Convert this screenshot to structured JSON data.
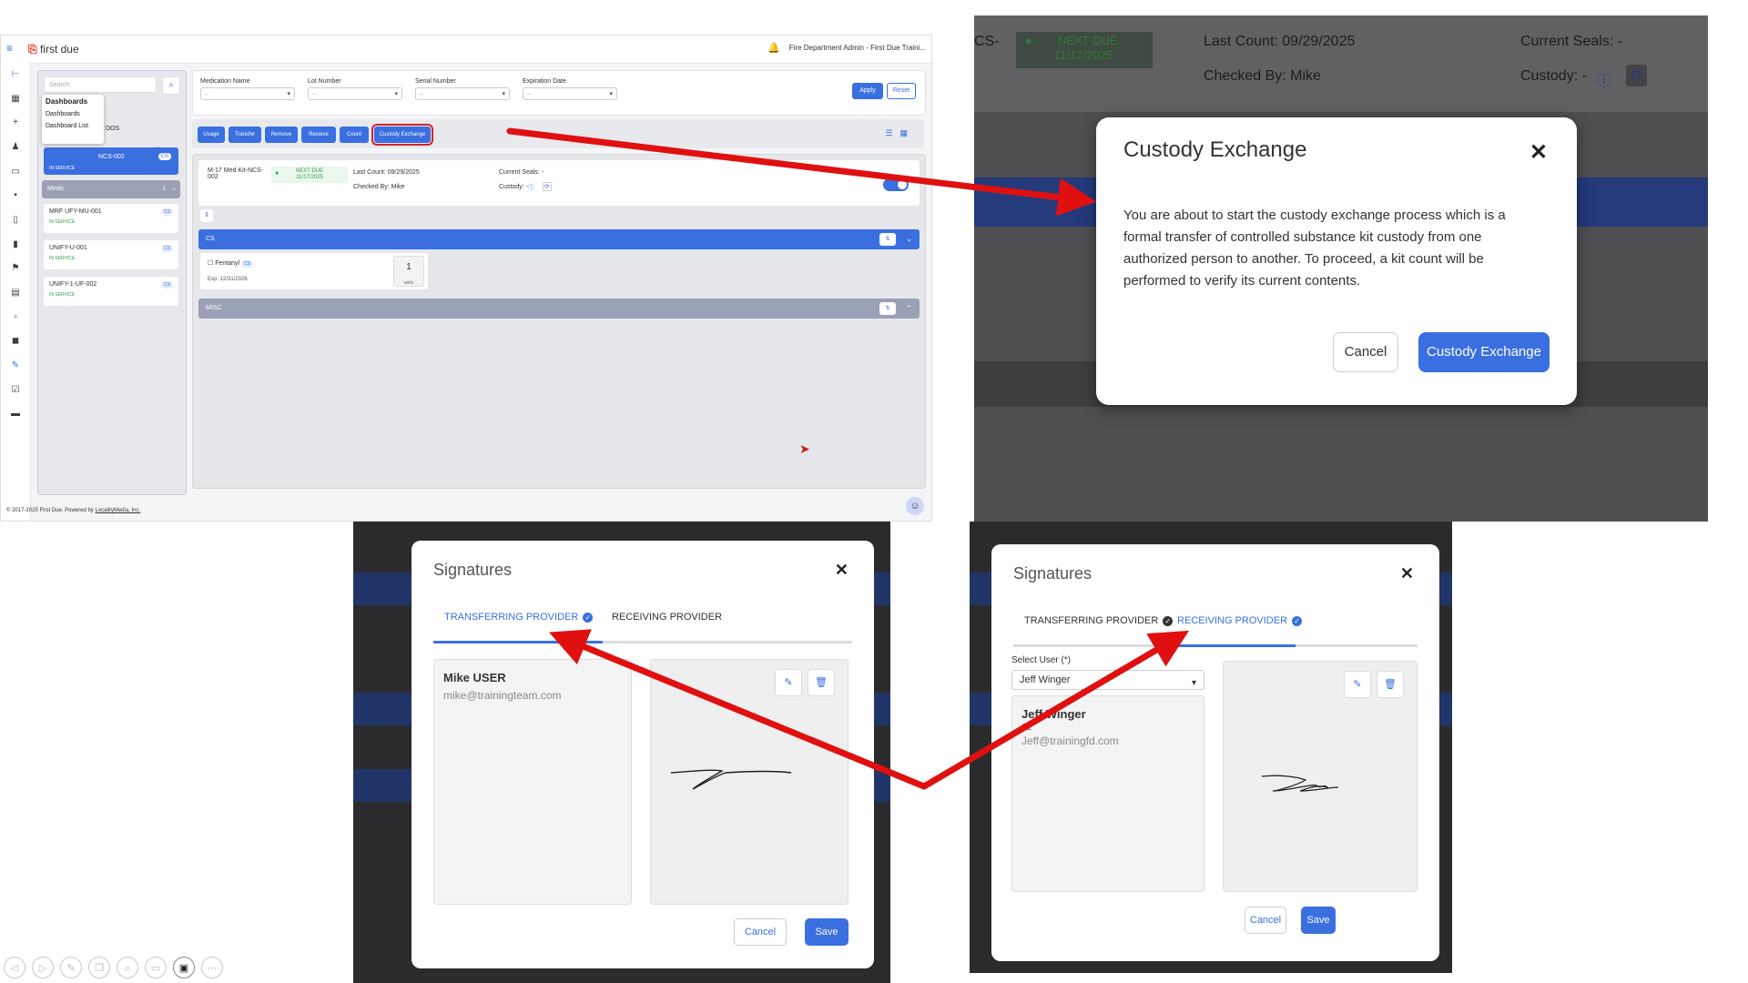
{
  "app": {
    "logo": "first due",
    "user_label": "Fire Department Admin - First Due Traini...",
    "search_placeholder": "Search",
    "dash_menu": [
      "Dashboards",
      "Dashboards",
      "Dashboard List"
    ],
    "partial_header": "DOS",
    "selected_kit": "NCS-002",
    "selected_kit_badge": "CS",
    "selected_kit_status": "IN SERVICE",
    "group_medic": "Medic",
    "group_medic_count": "1",
    "units": [
      {
        "name": "MRF UFY-MU-001",
        "status": "IN SERVICE",
        "badge": "CS"
      },
      {
        "name": "UNIFY-U-001",
        "status": "IN SERVICE",
        "badge": "CS"
      },
      {
        "name": "UNIFY-1-UF-002",
        "status": "IN SERVICE",
        "badge": "CS"
      }
    ],
    "filters": [
      {
        "label": "Medication Name",
        "value": "--"
      },
      {
        "label": "Lot Number",
        "value": "--"
      },
      {
        "label": "Serial Number",
        "value": "--"
      },
      {
        "label": "Expiration Date",
        "value": "--"
      }
    ],
    "apply": "Apply",
    "reset": "Reset",
    "actions": [
      "Usage",
      "Transfer",
      "Remove",
      "Receive",
      "Count",
      "Custody Exchange"
    ],
    "kit_name": "M-17 Med Kit-NCS-002",
    "next_due": "NEXT DUE",
    "next_due_date": "11/17/2025",
    "last_count": "Last Count: 09/29/2025",
    "checked_by": "Checked By: Mike",
    "current_seals": "Current Seals: -",
    "custody": "Custody: -",
    "section_cs": "CS",
    "section_misc": "MISC",
    "med_name": "Fentanyl",
    "med_badge": "CS",
    "med_exp": "Exp: 12/31/2026",
    "med_count": "1",
    "med_units": "units",
    "footer_text": "© 2017-2025 First Due. Powered by ",
    "footer_link": "LocalityMedia, Inc."
  },
  "custody_shot": {
    "bg_prefix": "CS-",
    "next_due": "NEXT DUE",
    "next_due_date": "11/17/2025",
    "last_count_label": "Last Count:",
    "last_count_value": "09/29/2025",
    "checked_by_label": "Checked By:",
    "checked_by_value": "Mike",
    "current_seals": "Current Seals: -",
    "custody": "Custody: -",
    "modal_title": "Custody Exchange",
    "modal_body": "You are about to start the custody exchange process which is a formal transfer of controlled substance kit custody from one authorized person to another. To proceed, a kit count will be performed to verify its current contents.",
    "cancel": "Cancel",
    "confirm": "Custody Exchange"
  },
  "sig_transfer": {
    "title": "Signatures",
    "tab1": "TRANSFERRING PROVIDER",
    "tab2": "RECEIVING PROVIDER",
    "name": "Mike USER",
    "email": "mike@trainingteam.com",
    "cancel": "Cancel",
    "save": "Save"
  },
  "sig_receive": {
    "title": "Signatures",
    "tab1": "TRANSFERRING PROVIDER",
    "tab2": "RECEIVING PROVIDER",
    "select_label": "Select User (*)",
    "select_value": "Jeff Winger",
    "name": "Jeff Winger",
    "sub": "11",
    "email": "Jeff@trainingfd.com",
    "cancel": "Cancel",
    "save": "Save"
  },
  "colors": {
    "accent": "#3a6fe0",
    "arrow": "#e01010",
    "status_green": "#2e9e4b"
  },
  "toolbar_icons": [
    "prev-icon",
    "next-icon",
    "pen-icon",
    "copy-icon",
    "zoom-icon",
    "caption-icon",
    "video-icon",
    "more-icon"
  ]
}
